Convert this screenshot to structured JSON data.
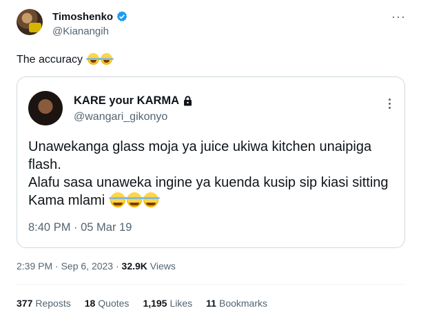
{
  "tweet": {
    "author_name": "Timoshenko",
    "author_handle": "@Kianangih",
    "text": "The accuracy",
    "timestamp": "2:39 PM · Sep 6, 2023 ·",
    "views_count": "32.9K",
    "views_label": "Views",
    "more_label": "···"
  },
  "quoted": {
    "author_name": "KARE your KARMA",
    "author_handle": "@wangari_gikonyo",
    "text": "Unawekanga glass moja ya juice ukiwa kitchen unaipiga flash.\nAlafu sasa unaweka ingine ya kuenda kusip sip kiasi sitting Kama mlami",
    "timestamp": "8:40 PM · 05 Mar 19"
  },
  "stats": {
    "reposts_count": "377",
    "reposts_label": "Reposts",
    "quotes_count": "18",
    "quotes_label": "Quotes",
    "likes_count": "1,195",
    "likes_label": "Likes",
    "bookmarks_count": "11",
    "bookmarks_label": "Bookmarks"
  },
  "icons": {
    "verified": "verified-badge-icon",
    "lock": "lock-icon",
    "emoji": "face-with-tears-of-joy-emoji"
  },
  "colors": {
    "verified_blue": "#1d9bf0",
    "secondary_text": "#536471",
    "border": "#cfd9de"
  }
}
